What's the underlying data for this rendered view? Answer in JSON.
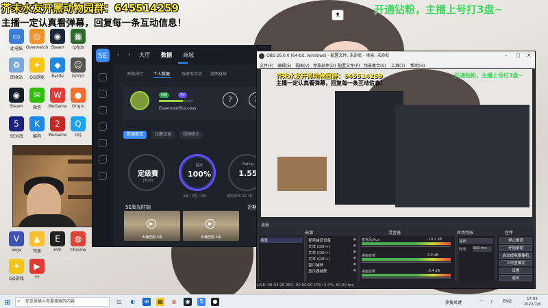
{
  "overlay": {
    "line1": "芥末水友开黑动物园群：645514259",
    "line2": "主播一定认真看弹幕，回复每一条互动信息！",
    "right": "开通钻粉，主播上号打3盘~"
  },
  "desktop_icons": [
    {
      "label": "此电脑",
      "icon": "computer-icon",
      "color": "#3b7dd8",
      "glyph": "▭"
    },
    {
      "label": "Overwatch",
      "icon": "overwatch-icon",
      "color": "#f0932b",
      "glyph": "◎"
    },
    {
      "label": "Steam",
      "icon": "steam-icon",
      "color": "#1b2838",
      "glyph": "◉"
    },
    {
      "label": "rpfjds",
      "icon": "app-icon",
      "color": "#2d6b2d",
      "glyph": "▦"
    },
    {
      "label": "回收站",
      "icon": "recycle-bin-icon",
      "color": "#7aa8d8",
      "glyph": "♻"
    },
    {
      "label": "QQ游戏",
      "icon": "qq-game-icon",
      "color": "#f5c518",
      "glyph": "✦"
    },
    {
      "label": "Battle",
      "icon": "battle-icon",
      "color": "#1e88e5",
      "glyph": "◆"
    },
    {
      "label": "GOGO",
      "icon": "profile-icon",
      "color": "#555",
      "glyph": "☺"
    },
    {
      "label": "Steam",
      "icon": "steam-icon",
      "color": "#15202b",
      "glyph": "◉"
    },
    {
      "label": "微信",
      "icon": "wechat-icon",
      "color": "#2dc100",
      "glyph": "✉"
    },
    {
      "label": "WeGame",
      "icon": "wegame-icon",
      "color": "#e53935",
      "glyph": "W"
    },
    {
      "label": "Origin",
      "icon": "origin-icon",
      "color": "#f56c2d",
      "glyph": "●"
    },
    {
      "label": "5E对战",
      "icon": "5e-icon",
      "color": "#1a237e",
      "glyph": "5"
    },
    {
      "label": "酷狗",
      "icon": "kugou-icon",
      "color": "#1e88e5",
      "glyph": "K"
    },
    {
      "label": "WeGame",
      "icon": "wegame-icon",
      "color": "#c62828",
      "glyph": "2"
    },
    {
      "label": "QQ",
      "icon": "qq-icon",
      "color": "#1da1f2",
      "glyph": "Q"
    },
    {
      "label": "Vega",
      "icon": "vega-icon",
      "color": "#3f51b5",
      "glyph": "V"
    },
    {
      "label": "完美",
      "icon": "perfect-icon",
      "color": "#fbc02d",
      "glyph": "▲"
    },
    {
      "label": "EVE",
      "icon": "eve-icon",
      "color": "#222",
      "glyph": "E"
    },
    {
      "label": "Chrome",
      "icon": "chrome-icon",
      "color": "#db4437",
      "glyph": "◍"
    },
    {
      "label": "QQ游戏",
      "icon": "qq-game-icon",
      "color": "#f5c518",
      "glyph": "✦"
    },
    {
      "label": "YY",
      "icon": "yy-icon",
      "color": "#e53935",
      "glyph": "▶"
    }
  ],
  "client": {
    "nav_tabs": [
      "大厅",
      "数据",
      "商城"
    ],
    "active_tab": "数据",
    "sub_tabs": [
      "天梯排行",
      "个人数据",
      "玩家库对抗",
      "地图挑战"
    ],
    "user": {
      "name": "EssenceofSuccess",
      "level": "D级"
    },
    "filters": [
      "数据概览",
      "比赛记录",
      "视频统计"
    ],
    "stats": [
      {
        "label": "",
        "value": "定级赛",
        "sub": "(3/10)"
      },
      {
        "label": "胜率",
        "value": "100%",
        "sub": "3场 / 3胜 / 0负"
      },
      {
        "label": "Rating",
        "value": "1.55",
        "sub": "场均ADR 16.78"
      }
    ],
    "highlight_title": "5E高光时刻",
    "recent_title": "近期",
    "clips": [
      "大桶巴配 4杀",
      "大桶巴配 4杀"
    ]
  },
  "obs": {
    "title": "OBS 26.0.0 (64-bit, windows) - 配置文件: 未命名 - 场景: 未命名",
    "menu": [
      "文件(F)",
      "编辑(E)",
      "视图(V)",
      "停靠部件(D)",
      "配置文件(P)",
      "场景集合(S)",
      "工具(T)",
      "帮助(H)"
    ],
    "docks": [
      "来源",
      "混音器",
      "转场特效",
      "控件"
    ],
    "scene_label": "场景",
    "sources": [
      "视频捕获设备",
      "文本 (GDI+)",
      "文本 (GDI+)",
      "文本 (GDI+)",
      "窗口捕获",
      "显示器捕获"
    ],
    "mixer": [
      {
        "name": "麦克风/Aux",
        "db": "-10.2 dB"
      },
      {
        "name": "桌面音频",
        "db": "0.0 dB"
      },
      {
        "name": "桌面音频",
        "db": "-9.4 dB"
      }
    ],
    "transition": {
      "type": "淡出",
      "duration_label": "时长",
      "duration": "300 ms"
    },
    "controls": [
      "停止推流",
      "开始录制",
      "启动虚拟摄像机",
      "工作室模式",
      "设置",
      "退出"
    ],
    "status": "LIVE: 00:03:26   REC: 00:00:00   CPU: 5.0%, 60.00 fps"
  },
  "taskbar": {
    "search_placeholder": "在这里输入你要搜索的内容",
    "tray_text": "热搜关键",
    "lang": "ENG",
    "time": "17:03",
    "date": "2022/7/6"
  }
}
